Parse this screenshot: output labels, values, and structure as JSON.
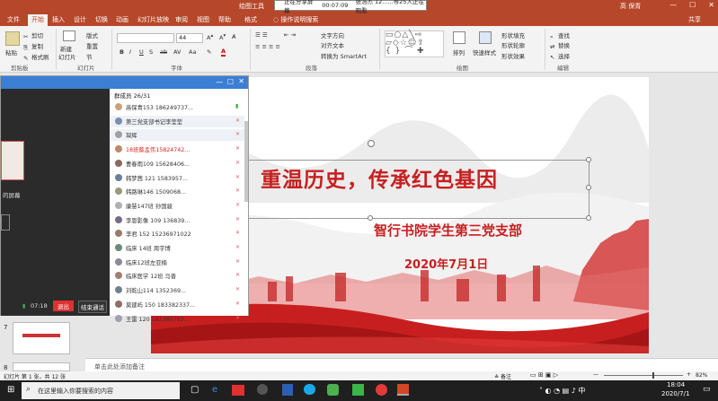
{
  "titlebar": {
    "drawing_tools": "绘图工具",
    "sharing": "正在分享屏幕",
    "timer": "00:07:09",
    "viewers": "张浩杰 12......等25人正在观看",
    "user": "高 保青",
    "min": "—",
    "max": "☐",
    "close": "✕"
  },
  "tabs": [
    "文件",
    "开始",
    "插入",
    "设计",
    "切换",
    "动画",
    "幻灯片放映",
    "审阅",
    "视图",
    "帮助",
    "格式"
  ],
  "tell_me": "操作说明搜索",
  "share_label": "共享",
  "ribbon": {
    "paste": "粘贴",
    "cut": "剪切",
    "copy": "复制",
    "format_painter": "格式刷",
    "new_slide": "新建",
    "new_slide_2": "幻灯片",
    "layout": "版式",
    "reset": "重置",
    "section": "节",
    "font_name": "",
    "font_size": "44",
    "text_direction": "文字方向",
    "align_text": "对齐文本",
    "smartart": "转换为 SmartArt",
    "arrange": "排列",
    "quick_styles": "快速样式",
    "shape_fill": "形状填充",
    "shape_outline": "形状轮廓",
    "shape_effects": "形状效果",
    "find": "查找",
    "replace": "替换",
    "select": "选择",
    "groups": {
      "clipboard": "剪贴板",
      "slides": "幻灯片",
      "font": "字体",
      "paragraph": "段落",
      "drawing": "绘图",
      "editing": "编辑"
    }
  },
  "call": {
    "members_label": "群成员 26/31",
    "time": "07:18",
    "exit": "退出",
    "end": "结束通话",
    "left_caption": "的屏幕",
    "members": [
      {
        "name": "高保青153  186249737...",
        "color": "#333"
      },
      {
        "name": "第三党支部书记李莹莹",
        "color": "#333"
      },
      {
        "name": "琛辉",
        "color": "#333"
      },
      {
        "name": "18班蔡孟伟15824742...",
        "color": "#d22"
      },
      {
        "name": "曹春雨109    15628406...",
        "color": "#333"
      },
      {
        "name": "韩梦茜 121 1583957...",
        "color": "#333"
      },
      {
        "name": "韩路琳146  1509068...",
        "color": "#333"
      },
      {
        "name": "康慧147班 孙国骏",
        "color": "#333"
      },
      {
        "name": "李恩影像  109  136839...",
        "color": "#333"
      },
      {
        "name": "李君 152 15236971022",
        "color": "#333"
      },
      {
        "name": "临床 14班 周宇博",
        "color": "#333"
      },
      {
        "name": "临床12班左亚楠",
        "color": "#333"
      },
      {
        "name": "临床医学 12班 马晋",
        "color": "#333"
      },
      {
        "name": "刘乾山114 1352369...",
        "color": "#333"
      },
      {
        "name": "莫建屿 150 183382337...",
        "color": "#333"
      },
      {
        "name": "王雷  120  182385783...",
        "color": "#333"
      }
    ]
  },
  "slide": {
    "title": "重温历史，传承红色基因",
    "subtitle": "智行书院学生第三党支部",
    "date": "2020年7月1日"
  },
  "thumb_numbers": [
    "7",
    "8"
  ],
  "notes_placeholder": "单击此处添加备注",
  "status": {
    "slide_info": "幻灯片 第 1 张，共 12 张",
    "notes": "备注",
    "zoom": "82%"
  },
  "taskbar": {
    "search_placeholder": "在这里输入你要搜索的内容",
    "time": "18:04",
    "date": "2020/7/1"
  }
}
